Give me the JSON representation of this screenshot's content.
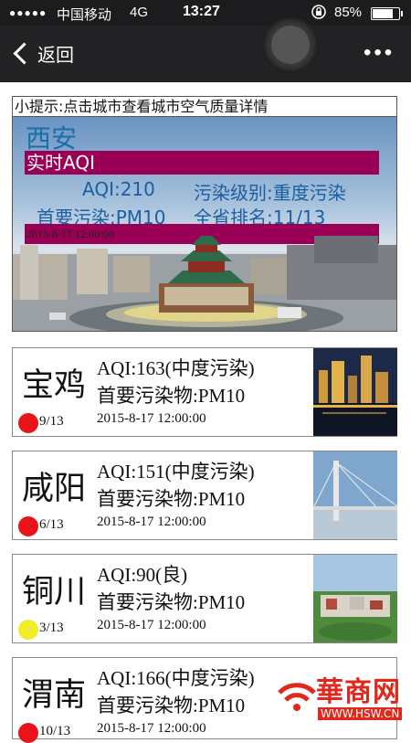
{
  "status_bar": {
    "signal": "●●●●●",
    "carrier": "中国移动",
    "network": "4G",
    "time": "13:27",
    "battery_percent": "85%",
    "battery_level": 0.85
  },
  "nav": {
    "back_label": "返回",
    "more_label": "•••"
  },
  "tip": "小提示:点击城市查看城市空气质量详情",
  "featured": {
    "city": "西安",
    "realtime_label": "实时AQI",
    "aqi": "AQI:210",
    "level": "污染级别:重度污染",
    "pollutant": "首要污染:PM10",
    "rank": "全省排名:11/13",
    "time": "2015-8-17 12:00:00"
  },
  "cities": [
    {
      "name": "宝鸡",
      "aqi": "AQI:163(中度污染)",
      "pollutant": "首要污染物:PM10",
      "time": "2015-8-17 12:00:00",
      "rank": "9/13",
      "dot_color": "#e8141a"
    },
    {
      "name": "咸阳",
      "aqi": "AQI:151(中度污染)",
      "pollutant": "首要污染物:PM10",
      "time": "2015-8-17 12:00:00",
      "rank": "6/13",
      "dot_color": "#e8141a"
    },
    {
      "name": "铜川",
      "aqi": "AQI:90(良)",
      "pollutant": "首要污染物:PM10",
      "time": "2015-8-17 12:00:00",
      "rank": "3/13",
      "dot_color": "#f2ec2a"
    },
    {
      "name": "渭南",
      "aqi": "AQI:166(中度污染)",
      "pollutant": "首要污染物:PM10",
      "time": "2015-8-17 12:00:00",
      "rank": "10/13",
      "dot_color": "#e8141a"
    }
  ],
  "watermark": {
    "brand": "華商网",
    "url": "WWW.HSW.CN"
  },
  "colors": {
    "accent_bar": "#990055",
    "city_title": "#1a6fa8",
    "pollution_red": "#e8141a",
    "good_yellow": "#f2ec2a"
  }
}
